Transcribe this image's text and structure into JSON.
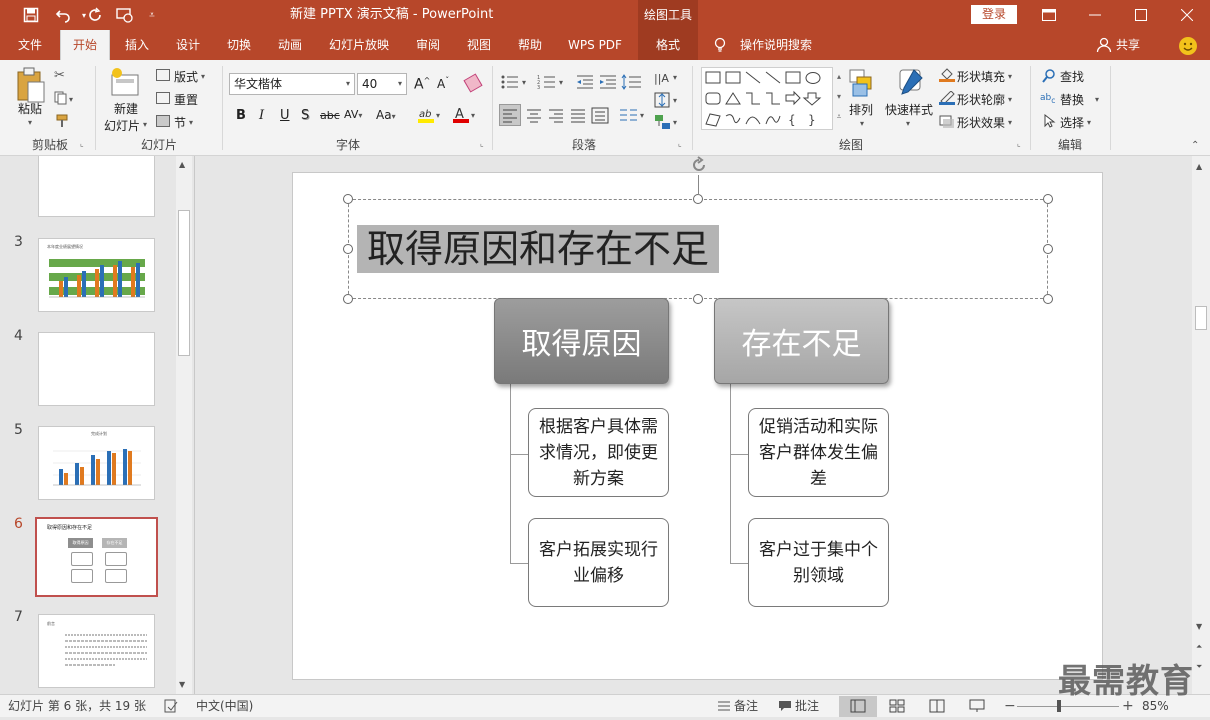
{
  "titlebar": {
    "document_title": "新建 PPTX 演示文稿  -  PowerPoint",
    "context_tool": "绘图工具",
    "login_label": "登录"
  },
  "tabs": [
    "文件",
    "开始",
    "插入",
    "设计",
    "切换",
    "动画",
    "幻灯片放映",
    "审阅",
    "视图",
    "帮助",
    "WPS PDF",
    "格式"
  ],
  "active_tab": "开始",
  "search_hint": "操作说明搜索",
  "share_label": "共享",
  "ribbon": {
    "clipboard": {
      "paste": "粘贴",
      "group": "剪贴板"
    },
    "slides": {
      "new_slide": "新建",
      "new_slide_2": "幻灯片",
      "layout": "版式",
      "reset": "重置",
      "section": "节",
      "group": "幻灯片"
    },
    "font": {
      "font_name": "华文楷体",
      "font_size": "40",
      "group": "字体",
      "bold": "B",
      "italic": "I",
      "underline": "U",
      "shadow": "S",
      "strike": "abc",
      "spacing": "AV",
      "case": "Aa"
    },
    "paragraph": {
      "group": "段落"
    },
    "drawing": {
      "arrange": "排列",
      "quick_styles": "快速样式",
      "fill": "形状填充",
      "outline": "形状轮廓",
      "effects": "形状效果",
      "group": "绘图"
    },
    "editing": {
      "find": "查找",
      "replace": "替换",
      "select": "选择",
      "group": "编辑"
    }
  },
  "thumbnails": [
    {
      "num": "3",
      "caption": "本年度业绩展望情况"
    },
    {
      "num": "4",
      "caption": ""
    },
    {
      "num": "5",
      "caption": "完成计划"
    },
    {
      "num": "6",
      "caption": "取得原因和存在不足",
      "b1": "取得原因",
      "b2": "存在不足"
    },
    {
      "num": "7",
      "caption": "前言"
    }
  ],
  "slide": {
    "title": "取得原因和存在不足",
    "left_head": "取得原因",
    "right_head": "存在不足",
    "left_items": [
      "根据客户具体需求情况，即使更新方案",
      "客户拓展实现行业偏移"
    ],
    "right_items": [
      "促销活动和实际客户群体发生偏差",
      "客户过于集中个别领域"
    ]
  },
  "status": {
    "slide_info": "幻灯片 第 6 张，共 19 张",
    "language": "中文(中国)",
    "notes": "备注",
    "comments": "批注",
    "zoom": "85%"
  },
  "watermark": "最需教育",
  "colors": {
    "brand": "#b7472a",
    "box_dark": "#8e8e8e",
    "box_light": "#b5b5b5"
  }
}
